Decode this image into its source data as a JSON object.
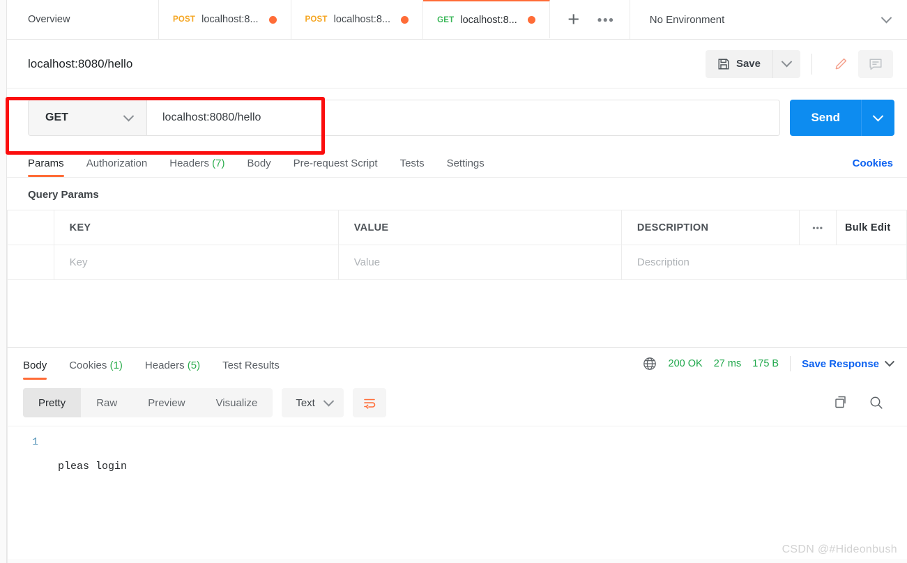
{
  "tabbar": {
    "tabs": [
      {
        "name": "Overview",
        "method": "",
        "label": "Overview",
        "dirty": false,
        "active": false
      },
      {
        "name": "post-tab-1",
        "method": "POST",
        "label": "localhost:8...",
        "dirty": true,
        "active": false
      },
      {
        "name": "post-tab-2",
        "method": "POST",
        "label": "localhost:8...",
        "dirty": true,
        "active": false
      },
      {
        "name": "get-tab",
        "method": "GET",
        "label": "localhost:8...",
        "dirty": true,
        "active": true
      }
    ],
    "new_tab_label": "+",
    "more_tabs_label": "•••",
    "environment": "No Environment"
  },
  "request_header": {
    "title": "localhost:8080/hello",
    "save_label": "Save"
  },
  "urlbar": {
    "method": "GET",
    "url": "localhost:8080/hello",
    "url_placeholder": "Enter URL or paste text",
    "send_label": "Send"
  },
  "request_tabs": {
    "items": [
      {
        "label": "Params",
        "count": "",
        "active": true
      },
      {
        "label": "Authorization",
        "count": "",
        "active": false
      },
      {
        "label": "Headers",
        "count": "(7)",
        "active": false
      },
      {
        "label": "Body",
        "count": "",
        "active": false
      },
      {
        "label": "Pre-request Script",
        "count": "",
        "active": false
      },
      {
        "label": "Tests",
        "count": "",
        "active": false
      },
      {
        "label": "Settings",
        "count": "",
        "active": false
      }
    ],
    "cookies_link": "Cookies"
  },
  "query_params": {
    "section_title": "Query Params",
    "headers": [
      "KEY",
      "VALUE",
      "DESCRIPTION"
    ],
    "more_label": "•••",
    "bulk_edit_label": "Bulk Edit",
    "rows": [
      {
        "key": "Key",
        "value": "Value",
        "description": "Description"
      }
    ]
  },
  "response": {
    "tabs": [
      {
        "label": "Body",
        "count": "",
        "active": true
      },
      {
        "label": "Cookies",
        "count": "(1)",
        "active": false
      },
      {
        "label": "Headers",
        "count": "(5)",
        "active": false
      },
      {
        "label": "Test Results",
        "count": "",
        "active": false
      }
    ],
    "status": "200 OK",
    "time": "27 ms",
    "size": "175 B",
    "save_response_label": "Save Response",
    "format_tabs": [
      {
        "label": "Pretty",
        "active": true
      },
      {
        "label": "Raw",
        "active": false
      },
      {
        "label": "Preview",
        "active": false
      },
      {
        "label": "Visualize",
        "active": false
      }
    ],
    "language": "Text",
    "body_lines": [
      {
        "number": "1",
        "text": "pleas login"
      }
    ]
  },
  "watermark": "CSDN @#Hideonbush",
  "colors": {
    "accent_orange": "#ff6c37",
    "send_blue": "#0d8cf0",
    "link_blue": "#0d62f0",
    "status_green": "#1ea74a",
    "post_orange": "#f5a623",
    "get_green": "#3ab758",
    "annotation_red": "#fb0d0d"
  }
}
